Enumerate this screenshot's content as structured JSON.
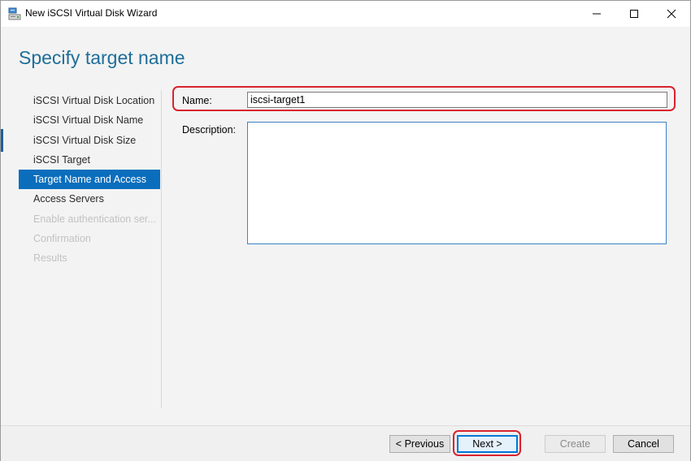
{
  "window": {
    "title": "New iSCSI Virtual Disk Wizard",
    "icon": "server-disk-icon"
  },
  "page": {
    "title": "Specify target name"
  },
  "steps": [
    {
      "label": "iSCSI Virtual Disk Location",
      "state": "completed"
    },
    {
      "label": "iSCSI Virtual Disk Name",
      "state": "completed"
    },
    {
      "label": "iSCSI Virtual Disk Size",
      "state": "completed"
    },
    {
      "label": "iSCSI Target",
      "state": "completed"
    },
    {
      "label": "Target Name and Access",
      "state": "active"
    },
    {
      "label": "Access Servers",
      "state": "enabled"
    },
    {
      "label": "Enable authentication ser...",
      "state": "disabled"
    },
    {
      "label": "Confirmation",
      "state": "disabled"
    },
    {
      "label": "Results",
      "state": "disabled"
    }
  ],
  "form": {
    "name_label": "Name:",
    "name_value": "iscsi-target1",
    "description_label": "Description:",
    "description_value": ""
  },
  "buttons": {
    "previous": "< Previous",
    "next": "Next >",
    "create": "Create",
    "cancel": "Cancel"
  },
  "colors": {
    "accent": "#0a6ebd",
    "title": "#1f6e9a",
    "highlight": "#d9232e"
  }
}
